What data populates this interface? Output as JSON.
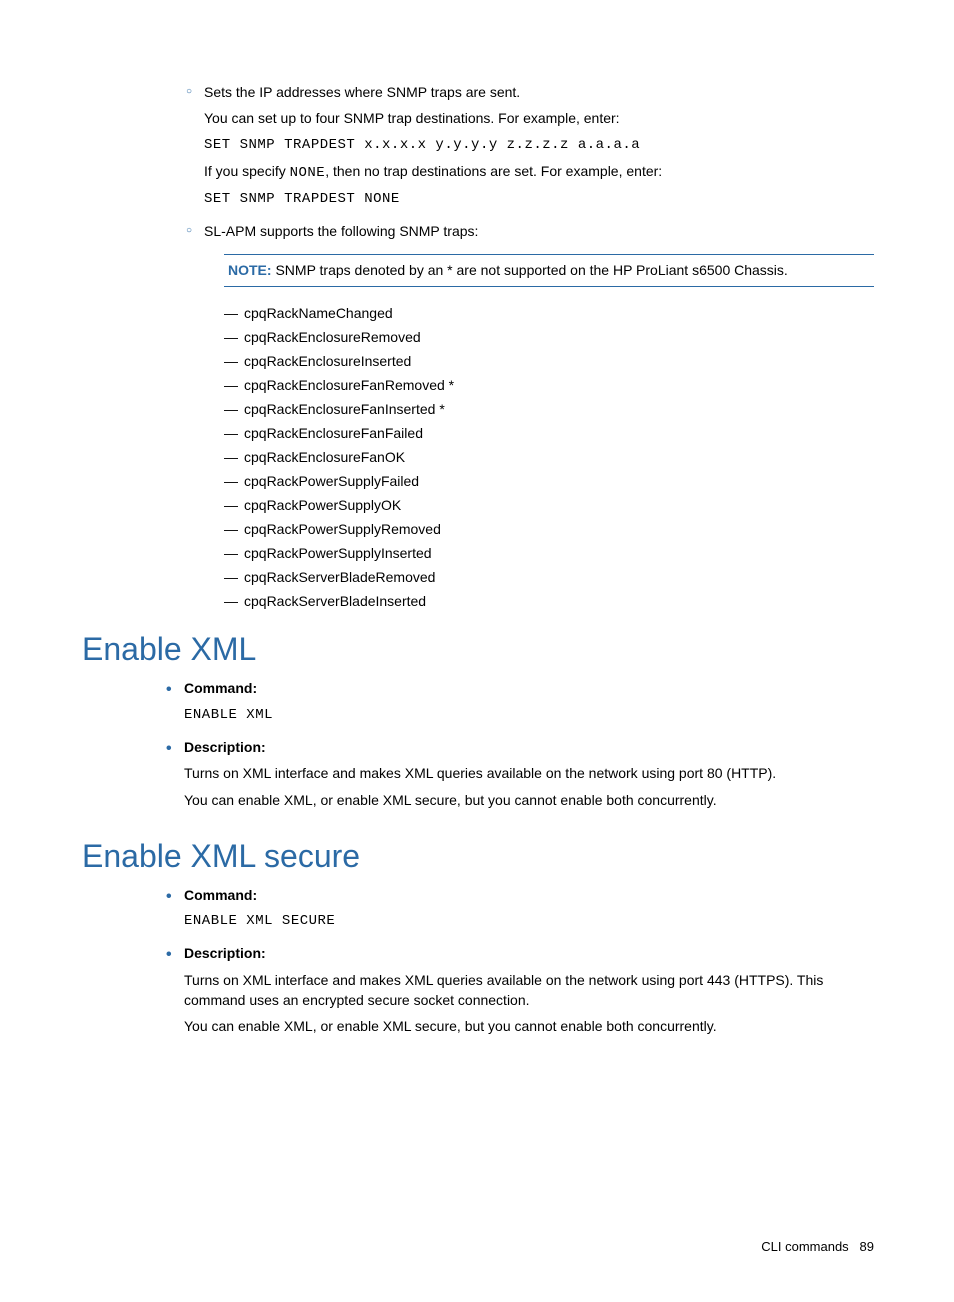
{
  "section1": {
    "item1": {
      "line1": "Sets the IP addresses where SNMP traps are sent.",
      "line2": "You can set up to four SNMP trap destinations. For example, enter:",
      "code1": "SET SNMP TRAPDEST x.x.x.x y.y.y.y z.z.z.z a.a.a.a",
      "line3_pre": "If you specify ",
      "line3_none": "NONE",
      "line3_post": ", then no trap destinations are set. For example, enter:",
      "code2": "SET SNMP TRAPDEST NONE"
    },
    "item2": {
      "line1": "SL-APM supports the following SNMP traps:"
    },
    "note": {
      "label": "NOTE:",
      "text": " SNMP traps denoted by an * are not supported on the HP ProLiant s6500 Chassis."
    },
    "traps": [
      "cpqRackNameChanged",
      "cpqRackEnclosureRemoved",
      "cpqRackEnclosureInserted",
      "cpqRackEnclosureFanRemoved *",
      "cpqRackEnclosureFanInserted *",
      "cpqRackEnclosureFanFailed",
      "cpqRackEnclosureFanOK",
      "cpqRackPowerSupplyFailed",
      "cpqRackPowerSupplyOK",
      "cpqRackPowerSupplyRemoved",
      "cpqRackPowerSupplyInserted",
      "cpqRackServerBladeRemoved",
      "cpqRackServerBladeInserted"
    ]
  },
  "enable_xml": {
    "heading": "Enable XML",
    "command_label": "Command:",
    "command_code": "ENABLE XML",
    "description_label": "Description:",
    "description_p1": "Turns on XML interface and makes XML queries available on the network using port 80 (HTTP).",
    "description_p2": "You can enable XML, or enable XML secure, but you cannot enable both concurrently."
  },
  "enable_xml_secure": {
    "heading": "Enable XML secure",
    "command_label": "Command:",
    "command_code": "ENABLE XML SECURE",
    "description_label": "Description:",
    "description_p1": "Turns on XML interface and makes XML queries available on the network using port 443 (HTTPS). This command uses an encrypted secure socket connection.",
    "description_p2": "You can enable XML, or enable XML secure, but you cannot enable both concurrently."
  },
  "footer": {
    "text": "CLI commands",
    "page": "89"
  }
}
